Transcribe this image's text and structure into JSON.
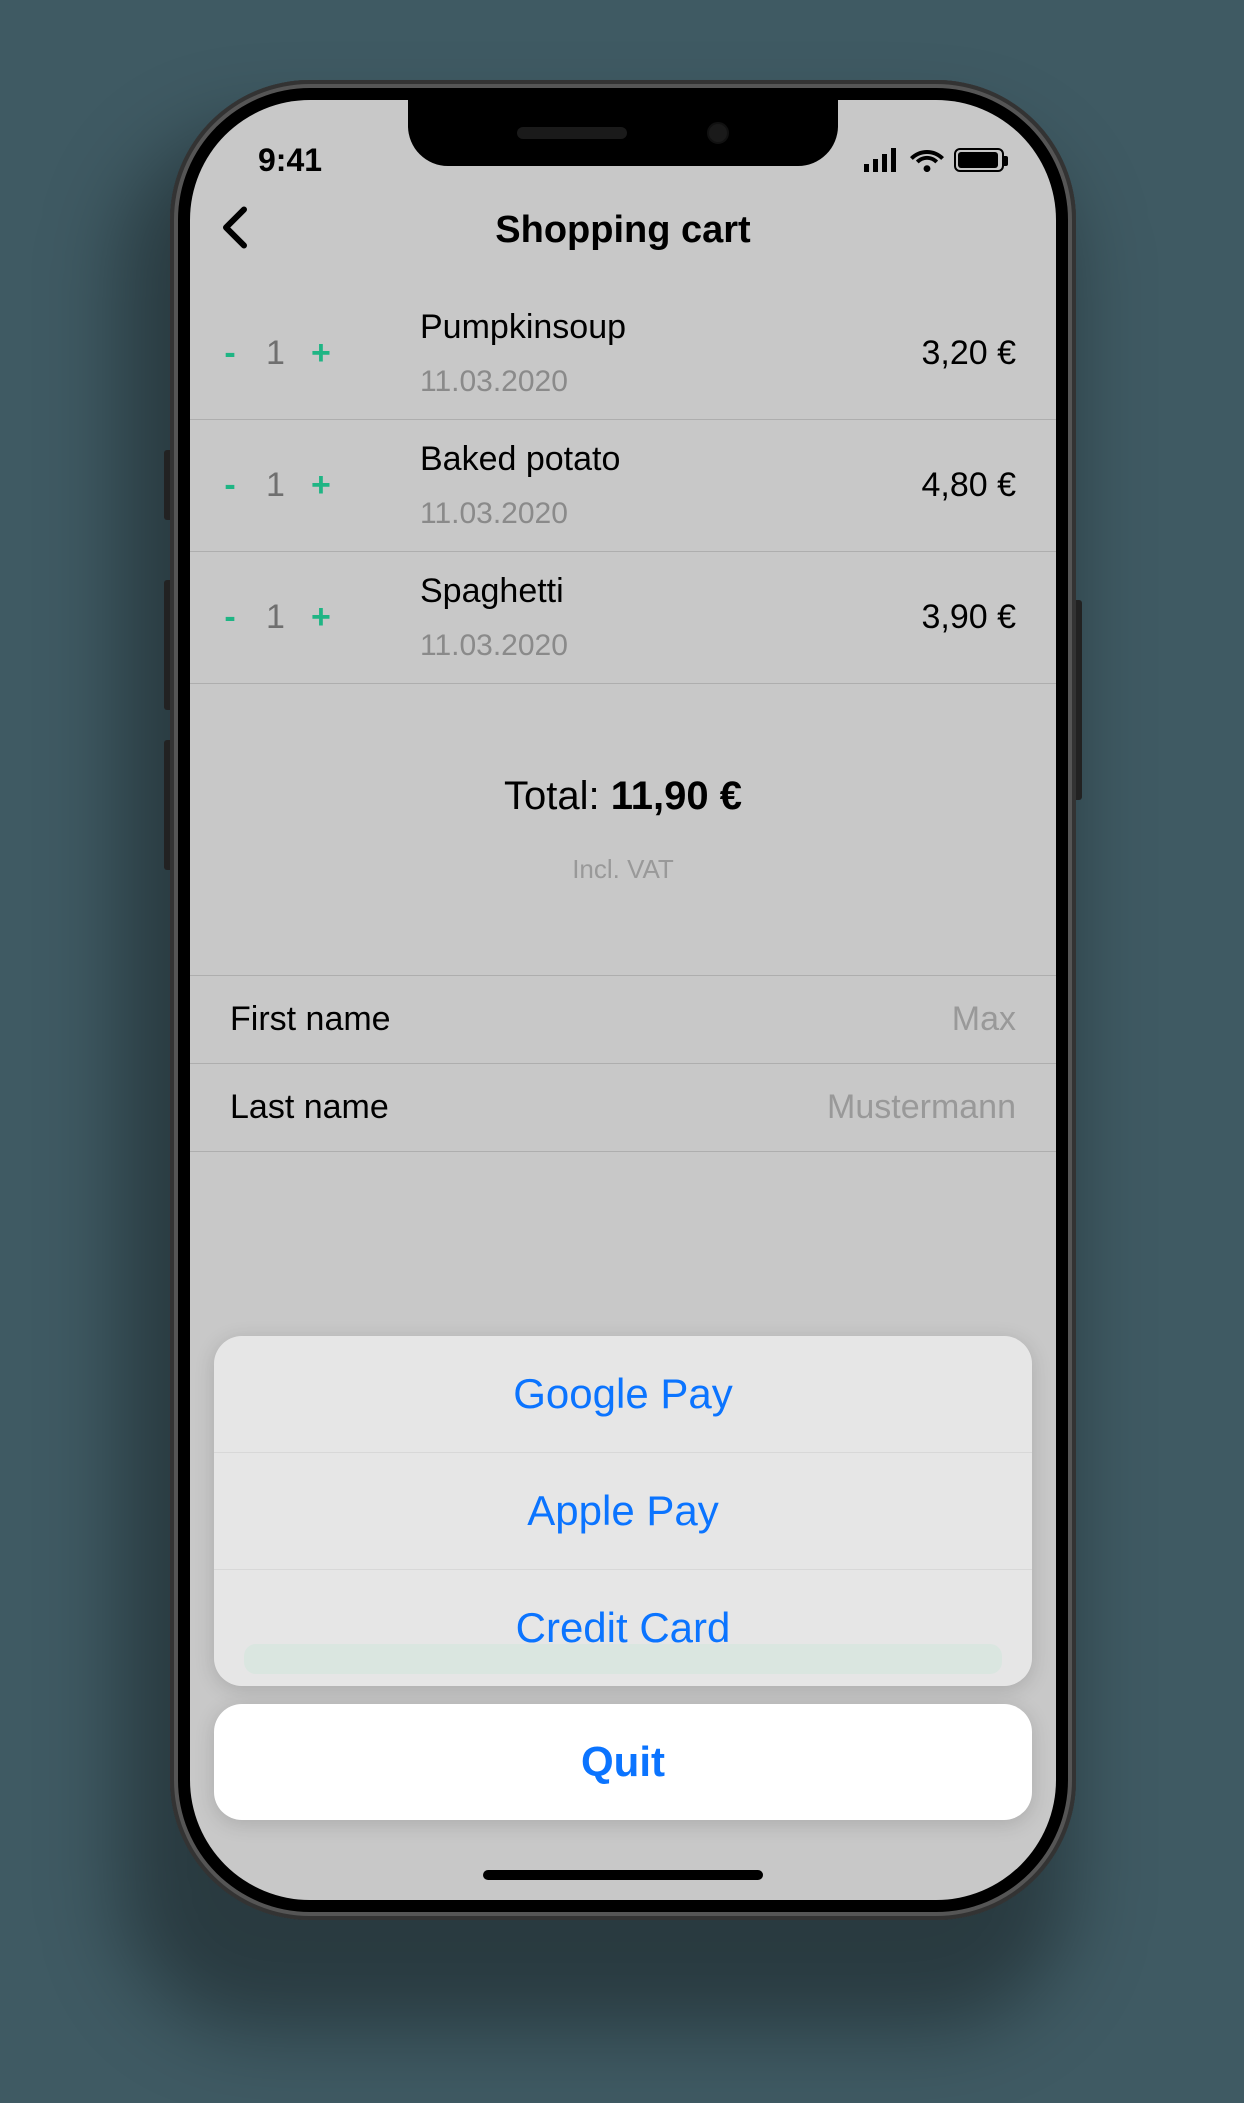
{
  "status": {
    "time": "9:41"
  },
  "header": {
    "title": "Shopping cart"
  },
  "cart": {
    "items": [
      {
        "name": "Pumpkinsoup",
        "date": "11.03.2020",
        "qty": "1",
        "price": "3,20 €"
      },
      {
        "name": "Baked potato",
        "date": "11.03.2020",
        "qty": "1",
        "price": "4,80 €"
      },
      {
        "name": "Spaghetti",
        "date": "11.03.2020",
        "qty": "1",
        "price": "3,90 €"
      }
    ],
    "total_label": "Total: ",
    "total_amount": "11,90 €",
    "vat_note": "Incl. VAT"
  },
  "form": {
    "first_name_label": "First name",
    "first_name_value": "Max",
    "last_name_label": "Last name",
    "last_name_value": "Mustermann"
  },
  "sheet": {
    "options": [
      {
        "label": "Google Pay"
      },
      {
        "label": "Apple Pay"
      },
      {
        "label": "Credit Card"
      }
    ],
    "cancel": "Quit"
  },
  "symbols": {
    "minus": "-",
    "plus": "+"
  }
}
